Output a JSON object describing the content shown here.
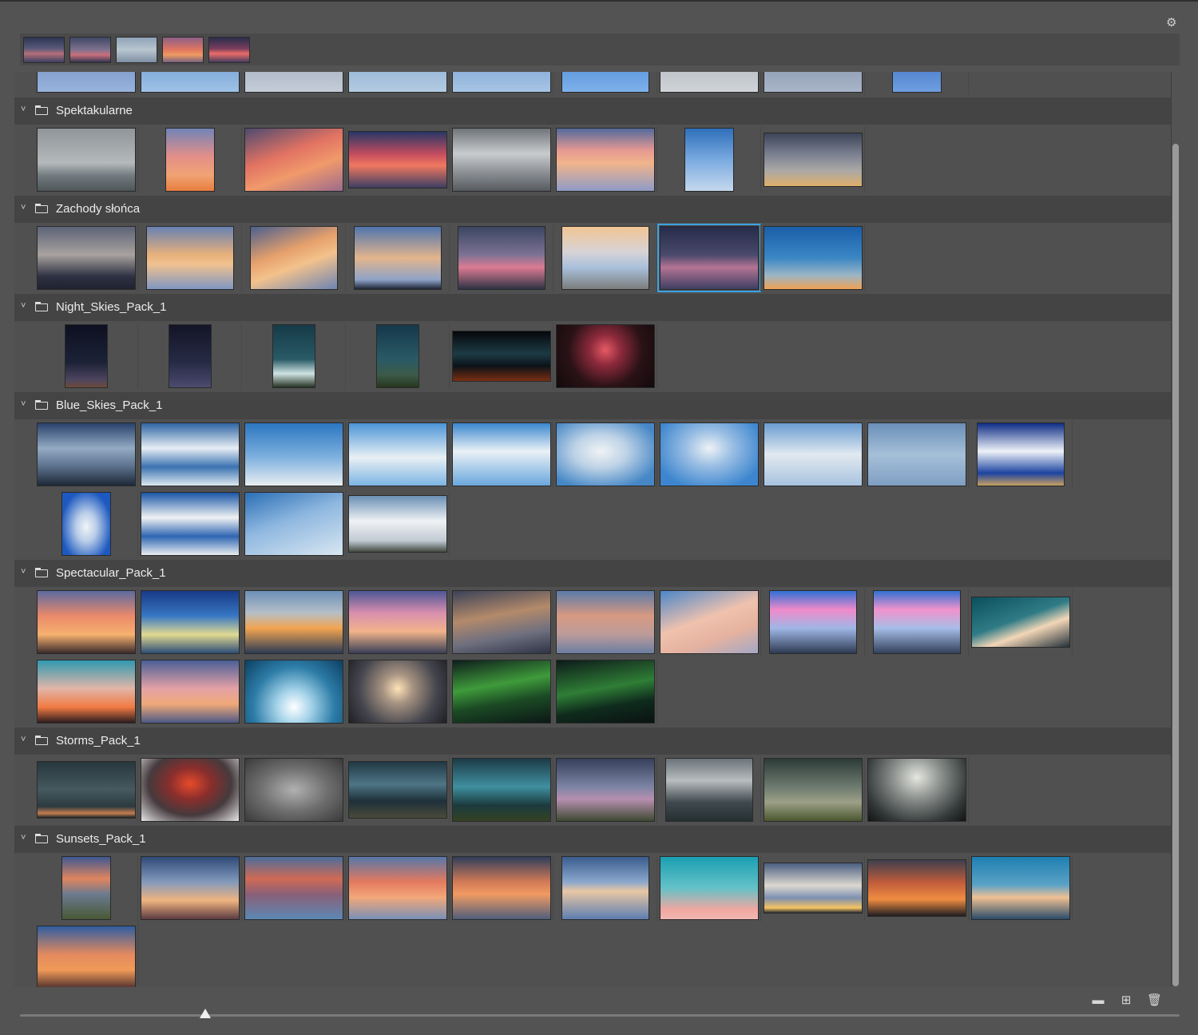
{
  "toolbar": {
    "settings_icon": "gear-icon",
    "settings_glyph": "⚙"
  },
  "recent": [
    {
      "g": "linear-gradient(180deg,#2c3553 0%,#5b5a7a 45%,#b5707a 65%,#394062 100%)"
    },
    {
      "g": "linear-gradient(180deg,#3e4866 0%,#80728f 50%,#c9707a 70%,#2f3450 100%)"
    },
    {
      "g": "linear-gradient(180deg,#8fa3b7 0%,#b9c6d0 50%,#7e8fa2 100%)"
    },
    {
      "g": "linear-gradient(180deg,#8d5f86 0%,#e27760 50%,#ef9b62 70%,#76607e 100%)"
    },
    {
      "g": "linear-gradient(180deg,#2a2d4c 0%,#7a3d5d 45%,#ea6d6a 65%,#413a5c 100%)"
    }
  ],
  "top_partial": [
    {
      "w": 124,
      "g": "linear-gradient(180deg,#5c7ab8,#98b3db)"
    },
    {
      "w": 124,
      "g": "linear-gradient(180deg,#4f83c2,#9fc2e6)"
    },
    {
      "w": 124,
      "g": "linear-gradient(180deg,#8a9ab0,#c4ccd7)"
    },
    {
      "w": 124,
      "g": "linear-gradient(180deg,#6f9ac8,#b4cbe3)"
    },
    {
      "w": 124,
      "g": "linear-gradient(180deg,#5d8ec8,#a7c4e4)"
    },
    {
      "w": 110,
      "g": "linear-gradient(180deg,#2f74cf,#7eb1ea)"
    },
    {
      "w": 124,
      "g": "linear-gradient(180deg,#9da4ad,#d0d4d8)"
    },
    {
      "w": 124,
      "g": "linear-gradient(180deg,#6c7f9e,#a9b5c8)"
    },
    {
      "w": 62,
      "g": "linear-gradient(180deg,#1e54b0,#6f9ee0)"
    }
  ],
  "groups": [
    {
      "name": "Spektakularne",
      "thumbs": [
        {
          "w": 124,
          "h": 80,
          "g": "linear-gradient(180deg,#8f9599 0%,#b5b9bb 55%,#737c80 75%,#4e5659 100%)"
        },
        {
          "w": 62,
          "h": 80,
          "g": "linear-gradient(180deg,#7184b6 0%,#e48f89 45%,#f0a374 75%,#e97d3e 100%)"
        },
        {
          "w": 124,
          "h": 80,
          "g": "linear-gradient(160deg,#4d4b70 0%,#e17263 40%,#f19a6b 65%,#9c6b8c 100%)"
        },
        {
          "w": 124,
          "h": 72,
          "g": "linear-gradient(180deg,#263766 0%,#c44d5f 40%,#f07860 60%,#3c3f63 100%)"
        },
        {
          "w": 124,
          "h": 80,
          "g": "linear-gradient(180deg,#6f7479 0%,#c9ccce 40%,#8d9195 70%,#565b60 100%)"
        },
        {
          "w": 124,
          "h": 80,
          "g": "linear-gradient(180deg,#536a9c 0%,#e59992 35%,#f1b48a 55%,#8f9bc7 100%)"
        },
        {
          "w": 62,
          "h": 80,
          "g": "linear-gradient(180deg,#2f6fba 0%,#7aaae0 50%,#c5d8ee 100%)"
        },
        {
          "w": 124,
          "h": 68,
          "g": "linear-gradient(180deg,#3d4458 0%,#7c8191 40%,#a9a8a6 70%,#dfae6a 100%)"
        }
      ]
    },
    {
      "name": "Zachody słońca",
      "thumbs": [
        {
          "w": 124,
          "h": 80,
          "g": "linear-gradient(180deg,#5c6377 0%,#a9a29f 45%,#2c3041 80%,#1f2330 100%)"
        },
        {
          "w": 110,
          "h": 80,
          "g": "linear-gradient(180deg,#6781b1 0%,#e8b17c 45%,#f0c28f 60%,#7f96c2 100%)"
        },
        {
          "w": 110,
          "h": 80,
          "g": "linear-gradient(160deg,#4a5f8e 0%,#e6a06c 40%,#f3c28c 60%,#6d84b3 100%)"
        },
        {
          "w": 110,
          "h": 80,
          "g": "linear-gradient(180deg,#4f74ad 0%,#e3b58c 50%,#8ea3c8 85%,#1f2434 100%)"
        },
        {
          "w": 110,
          "h": 80,
          "g": "linear-gradient(180deg,#3b4563 0%,#7d7293 45%,#dc7b93 65%,#2e3244 100%)"
        },
        {
          "w": 110,
          "h": 80,
          "g": "linear-gradient(180deg,#f1c593 0%,#d8d3d6 40%,#a9c0dc 65%,#7b7d7b 100%)"
        },
        {
          "w": 124,
          "h": 80,
          "g": "linear-gradient(180deg,#262c4a 0%,#49496b 45%,#b47393 65%,#3d3f63 100%)",
          "sel": true
        },
        {
          "w": 124,
          "h": 80,
          "g": "linear-gradient(180deg,#1a5ea9 0%,#3b87c4 50%,#9cb6c6 78%,#f0a253 100%)"
        }
      ]
    },
    {
      "name": "Night_Skies_Pack_1",
      "thumbs": [
        {
          "w": 54,
          "h": 80,
          "g": "linear-gradient(180deg,#0d1020 0%,#1c2237 60%,#4e4560 88%,#6d4a3a 100%)"
        },
        {
          "w": 54,
          "h": 80,
          "g": "linear-gradient(180deg,#131526 0%,#262b45 60%,#4c4b6f 100%)"
        },
        {
          "w": 54,
          "h": 80,
          "g": "linear-gradient(180deg,#163a48 0%,#285a66 55%,#cfe3e2 78%,#253223 100%)"
        },
        {
          "w": 54,
          "h": 80,
          "g": "linear-gradient(180deg,#15384a 0%,#2a5a66 55%,#3c5a48 80%,#27361f 100%)"
        },
        {
          "w": 124,
          "h": 64,
          "g": "linear-gradient(180deg,#05070b 0%,#1d3b45 45%,#0b1218 70%,#7a2f12 100%)"
        },
        {
          "w": 124,
          "h": 80,
          "g": "radial-gradient(circle at 50% 40%,#e65a64 0%,#8d2a3c 25%,#2a1216 60%,#120a0c 100%)"
        }
      ]
    },
    {
      "name": "Blue_Skies_Pack_1",
      "thumbs": [
        {
          "w": 124,
          "h": 80,
          "g": "linear-gradient(180deg,#29416b 0%,#94abc4 40%,#5a6f8b 70%,#1d2736 100%)"
        },
        {
          "w": 124,
          "h": 80,
          "g": "linear-gradient(180deg,#2e65a3 0%,#e7eef4 40%,#3a72b1 70%,#dde7ef 100%)"
        },
        {
          "w": 124,
          "h": 80,
          "g": "linear-gradient(180deg,#2b76c0 0%,#7fb1df 55%,#e9eef1 100%)"
        },
        {
          "w": 124,
          "h": 80,
          "g": "linear-gradient(180deg,#4b94d6 0%,#e9f0f4 55%,#7cb4e4 100%)"
        },
        {
          "w": 124,
          "h": 80,
          "g": "linear-gradient(180deg,#3a87cd 0%,#eaf1f6 45%,#6aa7dc 100%)"
        },
        {
          "w": 124,
          "h": 80,
          "g": "radial-gradient(ellipse at 45% 45%,#f0f3f5 0%,#bdd2e6 35%,#4687c6 80%)"
        },
        {
          "w": 124,
          "h": 80,
          "g": "radial-gradient(ellipse at 50% 40%,#eef2f5 0%,#98bde3 35%,#3d86cf 80%)"
        },
        {
          "w": 124,
          "h": 80,
          "g": "linear-gradient(180deg,#6a9cd0 0%,#e1e9f0 50%,#a8c3df 100%)"
        },
        {
          "w": 124,
          "h": 80,
          "g": "linear-gradient(180deg,#6a8fb9 0%,#a5bfd8 50%,#7f9fc3 100%)"
        },
        {
          "w": 110,
          "h": 80,
          "g": "linear-gradient(180deg,#0e2d86 0%,#eef2f8 45%,#1c44a0 80%,#c7a061 100%)"
        },
        {
          "w": 62,
          "h": 80,
          "g": "radial-gradient(ellipse at 50% 55%,#f2f4f7 0%,#b9cde8 30%,#1d59c0 75%)"
        },
        {
          "w": 124,
          "h": 80,
          "g": "linear-gradient(180deg,#1b56a8 0%,#f0f2f3 40%,#2f66b2 70%,#e9edf0 100%)"
        },
        {
          "w": 124,
          "h": 80,
          "g": "linear-gradient(160deg,#2b6fb6 0%,#8fb8e0 45%,#d8e6f1 100%)"
        },
        {
          "w": 124,
          "h": 72,
          "g": "linear-gradient(180deg,#6b8fb5 0%,#eff2f4 45%,#c1cad3 80%,#434a40 100%)"
        }
      ]
    },
    {
      "name": "Spectacular_Pack_1",
      "thumbs": [
        {
          "w": 124,
          "h": 80,
          "g": "linear-gradient(180deg,#5c6aa0 0%,#ea8a6b 40%,#f6b16f 70%,#3a2a2b 100%)"
        },
        {
          "w": 124,
          "h": 80,
          "g": "linear-gradient(180deg,#183a86 0%,#3777c3 40%,#e1d990 70%,#2b4c77 100%)"
        },
        {
          "w": 124,
          "h": 80,
          "g": "linear-gradient(180deg,#6c8fb7 0%,#b5bfc7 35%,#f2a450 60%,#2b3b55 100%)"
        },
        {
          "w": 124,
          "h": 80,
          "g": "linear-gradient(180deg,#4d5795 0%,#d88fae 35%,#f2b38a 65%,#383f57 100%)"
        },
        {
          "w": 124,
          "h": 80,
          "g": "linear-gradient(170deg,#3a4258 0%,#b48a6a 40%,#6e6f7f 70%,#2e3445 100%)"
        },
        {
          "w": 124,
          "h": 80,
          "g": "linear-gradient(180deg,#5a7aa8 0%,#d89a82 40%,#bb9b9a 70%,#6b7ea1 100%)"
        },
        {
          "w": 124,
          "h": 80,
          "g": "linear-gradient(160deg,#4c86c9 0%,#f0c2ae 45%,#e5b29f 70%,#a3a8c6 100%)"
        },
        {
          "w": 110,
          "h": 80,
          "g": "linear-gradient(180deg,#2f6fd6 0%,#f08ac9 30%,#9fb7e6 60%,#2e3a52 100%)"
        },
        {
          "w": 110,
          "h": 80,
          "g": "linear-gradient(180deg,#3170d4 0%,#f193cc 30%,#a6bde8 60%,#32405a 100%)"
        },
        {
          "w": 124,
          "h": 64,
          "g": "linear-gradient(160deg,#0b4f5b 0%,#2f7b85 45%,#f2d6b7 65%,#23313a 100%)"
        },
        {
          "w": 124,
          "h": 80,
          "g": "linear-gradient(180deg,#2f99b0 0%,#e1b5a8 45%,#f17a43 75%,#2a1c1e 100%)"
        },
        {
          "w": 124,
          "h": 80,
          "g": "linear-gradient(180deg,#4a5f96 0%,#e4a1a6 45%,#f0a978 70%,#4d5986 100%)"
        },
        {
          "w": 124,
          "h": 80,
          "g": "radial-gradient(circle at 50% 75%,#ffffff 0%,#a6d4ea 25%,#2d7da8 60%,#0c3f62 100%)"
        },
        {
          "w": 124,
          "h": 80,
          "g": "radial-gradient(circle at 50% 45%,#ffe4b8 0%,#a79382 25%,#45464e 65%,#1e1f24 100%)"
        },
        {
          "w": 124,
          "h": 80,
          "g": "linear-gradient(170deg,#0e1d1c 0%,#3f9b3b 40%,#1b4a24 65%,#0c1716 100%)"
        },
        {
          "w": 124,
          "h": 80,
          "g": "linear-gradient(170deg,#0d1a19 0%,#2f7e36 45%,#0f2b1d 70%,#0a1212 100%)"
        }
      ]
    },
    {
      "name": "Storms_Pack_1",
      "thumbs": [
        {
          "w": 124,
          "h": 72,
          "g": "linear-gradient(180deg,#27363d 0%,#45595f 50%,#2c3a3f 80%,#c47d4f 92%,#1d2427 100%)"
        },
        {
          "w": 124,
          "h": 80,
          "g": "radial-gradient(ellipse at 50% 40%,#e74a2b 0%,#8a2e2c 30%,#453a3d 60%,#e5e5e5 100%)"
        },
        {
          "w": 124,
          "h": 80,
          "g": "radial-gradient(ellipse at 50% 50%,#b1b1b1 0%,#6e6e6e 50%,#3a3a3a 100%)"
        },
        {
          "w": 124,
          "h": 72,
          "g": "linear-gradient(180deg,#203844 0%,#4e7585 40%,#1e303a 70%,#4a4a3a 100%)"
        },
        {
          "w": 124,
          "h": 80,
          "g": "linear-gradient(180deg,#1c3b46 0%,#3f8fa0 45%,#1b3a3d 75%,#354223 100%)"
        },
        {
          "w": 124,
          "h": 80,
          "g": "linear-gradient(180deg,#35405a 0%,#7c84a4 45%,#b78fb0 65%,#3e4a33 100%)"
        },
        {
          "w": 110,
          "h": 80,
          "g": "linear-gradient(180deg,#6a7479 0%,#b8bdbf 35%,#404a4e 70%,#263033 100%)"
        },
        {
          "w": 124,
          "h": 80,
          "g": "linear-gradient(180deg,#2d3b38 0%,#6c7a6f 45%,#9ca086 70%,#4a5630 100%)"
        },
        {
          "w": 124,
          "h": 80,
          "g": "radial-gradient(ellipse at 50% 30%,#e6e6e0 0%,#8c918e 35%,#34393a 75%,#121414 100%)"
        }
      ]
    },
    {
      "name": "Sunsets_Pack_1",
      "thumbs": [
        {
          "w": 62,
          "h": 80,
          "g": "linear-gradient(180deg,#3d5892 0%,#e0855f 35%,#6b7a8e 60%,#495936 100%)"
        },
        {
          "w": 124,
          "h": 80,
          "g": "linear-gradient(180deg,#2f4a78 0%,#8299bb 40%,#f0b47f 70%,#5a3a40 100%)"
        },
        {
          "w": 124,
          "h": 80,
          "g": "linear-gradient(180deg,#4a6d9a 0%,#d06a55 35%,#8a6078 60%,#5c88b5 100%)"
        },
        {
          "w": 124,
          "h": 80,
          "g": "linear-gradient(180deg,#5577a8 0%,#e47a5f 40%,#f2a879 65%,#7890b7 100%)"
        },
        {
          "w": 124,
          "h": 80,
          "g": "linear-gradient(180deg,#2f3e5a 0%,#d27a57 40%,#f09a62 60%,#4f5e7c 100%)"
        },
        {
          "w": 110,
          "h": 80,
          "g": "linear-gradient(180deg,#3a5c8d 0%,#8aa7cc 40%,#e8c7a4 55%,#5c7eb0 100%)"
        },
        {
          "w": 124,
          "h": 80,
          "g": "linear-gradient(180deg,#1a9fb1 0%,#64c2c8 50%,#f1a7a0 85%,#f0b8b1 100%)"
        },
        {
          "w": 124,
          "h": 64,
          "g": "linear-gradient(180deg,#4b5f82 0%,#dcd8d0 45%,#7c90b0 70%,#f6c463 90%,#2a2d34 100%)"
        },
        {
          "w": 124,
          "h": 72,
          "g": "linear-gradient(180deg,#3f3f4e 0%,#c05c3b 40%,#f08d41 70%,#1e1d22 100%)"
        },
        {
          "w": 124,
          "h": 80,
          "g": "linear-gradient(180deg,#1e7fb1 0%,#5aa2c6 45%,#f0c093 65%,#2a4b6a 100%)"
        },
        {
          "w": 124,
          "h": 80,
          "g": "linear-gradient(180deg,#2e5da0 0%,#e48a5f 45%,#f09a58 70%,#4d2e2e 100%)"
        }
      ]
    }
  ],
  "footer": {
    "new_folder_icon": "folder-icon",
    "new_folder_glyph": "▬",
    "add_icon": "add-icon",
    "add_glyph": "⊞",
    "delete_icon": "trash-icon",
    "delete_glyph": "🗑",
    "chevron": "⌄"
  },
  "thumbnail_size_fraction": 0.16
}
